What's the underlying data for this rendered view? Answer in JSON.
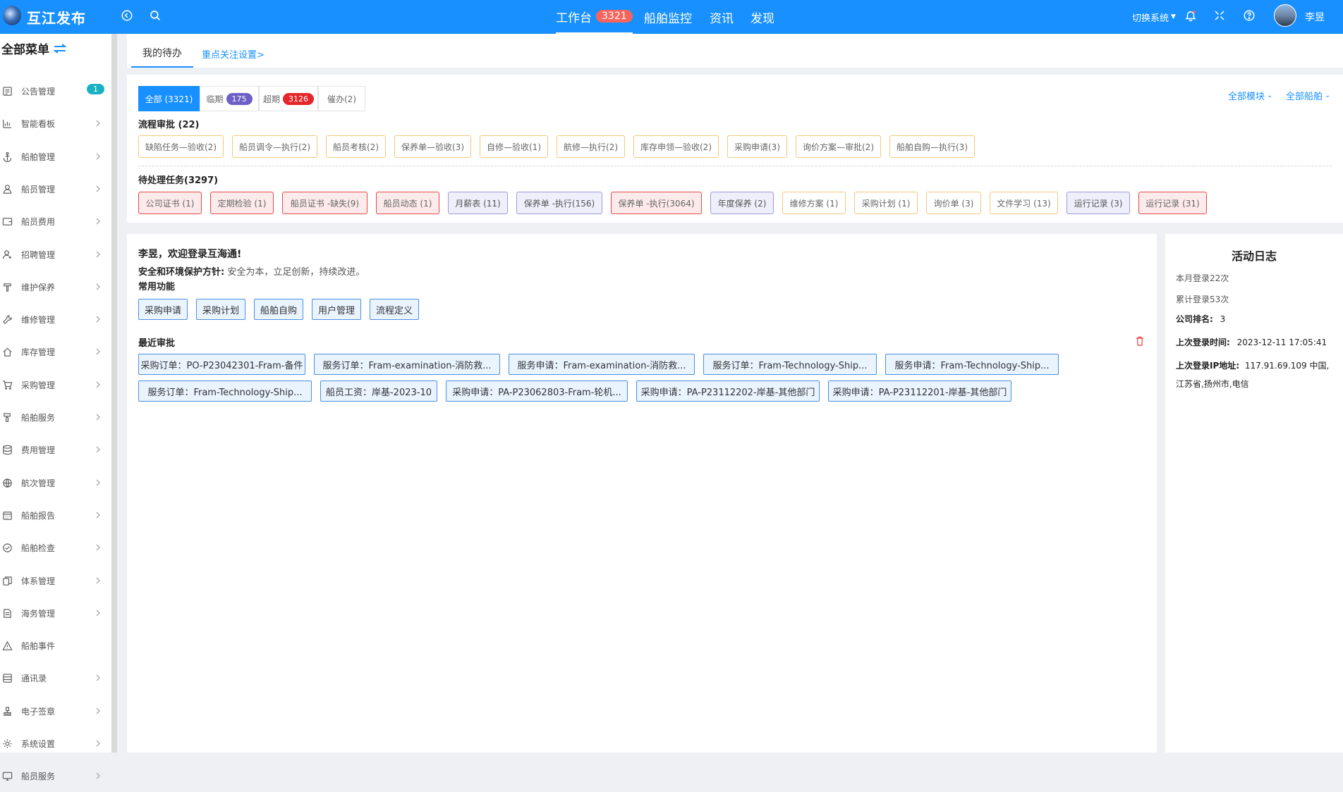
{
  "app": {
    "brand": "互江发布"
  },
  "header": {
    "nav": [
      {
        "label": "工作台",
        "badge": "3321"
      },
      {
        "label": "船舶监控"
      },
      {
        "label": "资讯"
      },
      {
        "label": "发现"
      }
    ],
    "switch_system": "切换系统",
    "user_name": "李昱",
    "accent": "#1890ff"
  },
  "sidebar": {
    "title": "全部菜单",
    "items": [
      {
        "label": "公告管理",
        "icon": "notice-icon",
        "count": "1"
      },
      {
        "label": "智能看板",
        "icon": "chart-icon"
      },
      {
        "label": "船舶管理",
        "icon": "anchor-icon"
      },
      {
        "label": "船员管理",
        "icon": "user-icon"
      },
      {
        "label": "船员费用",
        "icon": "wallet-icon"
      },
      {
        "label": "招聘管理",
        "icon": "recruit-icon"
      },
      {
        "label": "维护保养",
        "icon": "tool-icon"
      },
      {
        "label": "维修管理",
        "icon": "wrench-icon"
      },
      {
        "label": "库存管理",
        "icon": "home-icon"
      },
      {
        "label": "采购管理",
        "icon": "cart-icon"
      },
      {
        "label": "船舶服务",
        "icon": "brush-icon"
      },
      {
        "label": "费用管理",
        "icon": "database-icon"
      },
      {
        "label": "航次管理",
        "icon": "globe-icon"
      },
      {
        "label": "船舶报告",
        "icon": "calendar-icon"
      },
      {
        "label": "船舶检查",
        "icon": "check-icon"
      },
      {
        "label": "体系管理",
        "icon": "copy-icon"
      },
      {
        "label": "海务管理",
        "icon": "doc-icon"
      },
      {
        "label": "船舶事件",
        "icon": "warning-icon"
      },
      {
        "label": "通讯录",
        "icon": "contacts-icon"
      },
      {
        "label": "电子签章",
        "icon": "stamp-icon"
      },
      {
        "label": "系统设置",
        "icon": "gear-icon"
      },
      {
        "label": "船员服务",
        "icon": "monitor-icon"
      }
    ]
  },
  "tabs": {
    "my_todo": "我的待办",
    "focus_setting": "重点关注设置>"
  },
  "filter_tabs": [
    {
      "label": "全部 (3321)"
    },
    {
      "label": "临期",
      "badge": "175",
      "color": "#6c5fc7"
    },
    {
      "label": "超期",
      "badge": "3126",
      "color": "#e5262b"
    },
    {
      "label": "催办(2)"
    }
  ],
  "right_filters": {
    "modules": "全部模块",
    "ships": "全部船舶"
  },
  "approval": {
    "title": "流程审批 (22)",
    "chips": [
      "缺陷任务—验收(2)",
      "船员调令—执行(2)",
      "船员考核(2)",
      "保养单—验收(3)",
      "自修—验收(1)",
      "航修—执行(2)",
      "库存申领—验收(2)",
      "采购申请(3)",
      "询价方案—审批(2)",
      "船舶自购—执行(3)"
    ]
  },
  "tasks": {
    "title": "待处理任务(3297)",
    "chips": [
      {
        "label": "公司证书 (1)",
        "kind": "red"
      },
      {
        "label": "定期检验 (1)",
        "kind": "red"
      },
      {
        "label": "船员证书 -缺失(9)",
        "kind": "red"
      },
      {
        "label": "船员动态 (1)",
        "kind": "red"
      },
      {
        "label": "月薪表 (11)",
        "kind": "purple"
      },
      {
        "label": "保养单 -执行(156)",
        "kind": "purple"
      },
      {
        "label": "保养单 -执行(3064)",
        "kind": "red"
      },
      {
        "label": "年度保养 (2)",
        "kind": "purple"
      },
      {
        "label": "维修方案 (1)",
        "kind": "yellow"
      },
      {
        "label": "采购计划 (1)",
        "kind": "yellow"
      },
      {
        "label": "询价单 (3)",
        "kind": "yellow"
      },
      {
        "label": "文件学习 (13)",
        "kind": "yellow"
      },
      {
        "label": "运行记录 (3)",
        "kind": "purple"
      },
      {
        "label": "运行记录 (31)",
        "kind": "red"
      }
    ]
  },
  "welcome": {
    "greeting": "李昱，欢迎登录互海通!",
    "policy_label": "安全和环境保护方针:",
    "policy_text": "安全为本，立足创新，持续改进。",
    "common_title": "常用功能",
    "common": [
      "采购申请",
      "采购计划",
      "船舶自购",
      "用户管理",
      "流程定义"
    ],
    "recent_title": "最近审批",
    "recent": [
      "采购订单：PO-P23042301-Fram-备件",
      "服务订单：Fram-examination-消防救...",
      "服务申请：Fram-examination-消防救...",
      "服务订单：Fram-Technology-Ship...",
      "服务申请：Fram-Technology-Ship...",
      "服务订单：Fram-Technology-Ship...",
      "船员工资：岸基-2023-10",
      "采购申请：PA-P23062803-Fram-轮机...",
      "采购申请：PA-P23112202-岸基-其他部门",
      "采购申请：PA-P23112201-岸基-其他部门"
    ]
  },
  "activity": {
    "title": "活动日志",
    "month_login": "本月登录22次",
    "total_login": "累计登录53次",
    "rank_label": "公司排名:",
    "rank_value": "3",
    "last_time_label": "上次登录时间:",
    "last_time_value": "2023-12-11 17:05:41",
    "last_ip_label": "上次登录IP地址:",
    "last_ip_value": "117.91.69.109 中国,江苏省,扬州市,电信"
  }
}
